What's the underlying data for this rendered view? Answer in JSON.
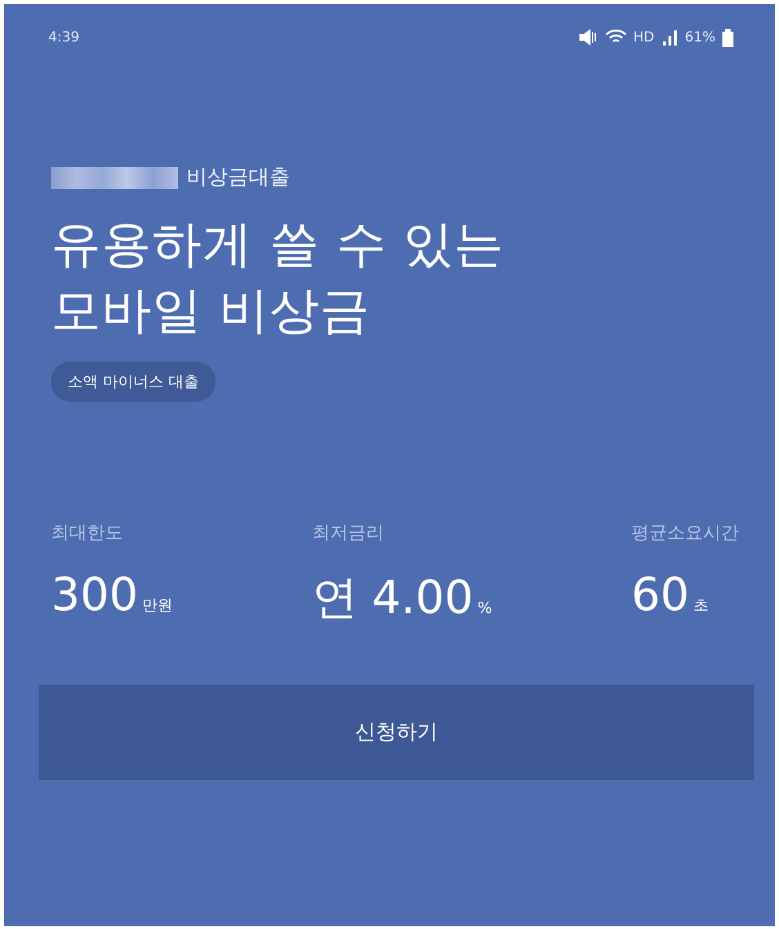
{
  "status_bar": {
    "time": "4:39",
    "network": "HD",
    "battery": "61%"
  },
  "brand": {
    "redacted": true,
    "product": "비상금대출"
  },
  "headline": [
    "유용하게 쓸 수 있는",
    "모바일 비상금"
  ],
  "tag": "소액 마이너스 대출",
  "stats": [
    {
      "label": "최대한도",
      "value": "300",
      "unit": "만원"
    },
    {
      "label": "최저금리",
      "value": "연 4.00",
      "unit": "%"
    },
    {
      "label": "평균소요시간",
      "value": "60",
      "unit": "초"
    }
  ],
  "button": "신청하기"
}
